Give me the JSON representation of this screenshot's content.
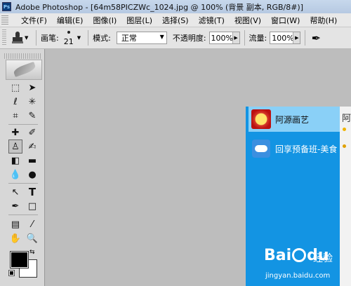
{
  "window": {
    "app_logo": "Ps",
    "title": "Adobe Photoshop - [64m58PICZWc_1024.jpg @ 100% (背景 副本, RGB/8#)]"
  },
  "menu": [
    "文件(F)",
    "编辑(E)",
    "图像(I)",
    "图层(L)",
    "选择(S)",
    "滤镜(T)",
    "视图(V)",
    "窗口(W)",
    "帮助(H)"
  ],
  "options": {
    "brush_label": "画笔:",
    "brush_size": "21",
    "mode_label": "模式:",
    "mode_value": "正常",
    "opacity_label": "不透明度:",
    "opacity_value": "100%",
    "flow_label": "流量:",
    "flow_value": "100%"
  },
  "colors": {
    "foreground": "#000000",
    "background": "#ffffff",
    "chat_panel_bg": "#1394e3",
    "chat_selected_bg": "#8ad0f7"
  },
  "toolbox": {
    "active_tool": "clone-stamp",
    "tools": [
      "marquee",
      "move",
      "lasso",
      "magic-wand",
      "crop",
      "slice",
      "healing-brush",
      "brush",
      "clone-stamp",
      "history-brush",
      "eraser",
      "gradient",
      "blur",
      "dodge",
      "path-selection",
      "type",
      "pen",
      "shape",
      "notes",
      "eyedropper",
      "hand",
      "zoom"
    ]
  },
  "chat": {
    "items": [
      {
        "name": "阿源画艺",
        "icon": "avatar-seal-icon",
        "selected": true
      },
      {
        "name": "回享预备班-美食",
        "icon": "gamepad-icon",
        "selected": false
      }
    ],
    "side_letter": "阿"
  },
  "watermark": {
    "brand": "Bai",
    "brand_suffix": "du",
    "product": "经验",
    "url": "jingyan.baidu.com"
  }
}
